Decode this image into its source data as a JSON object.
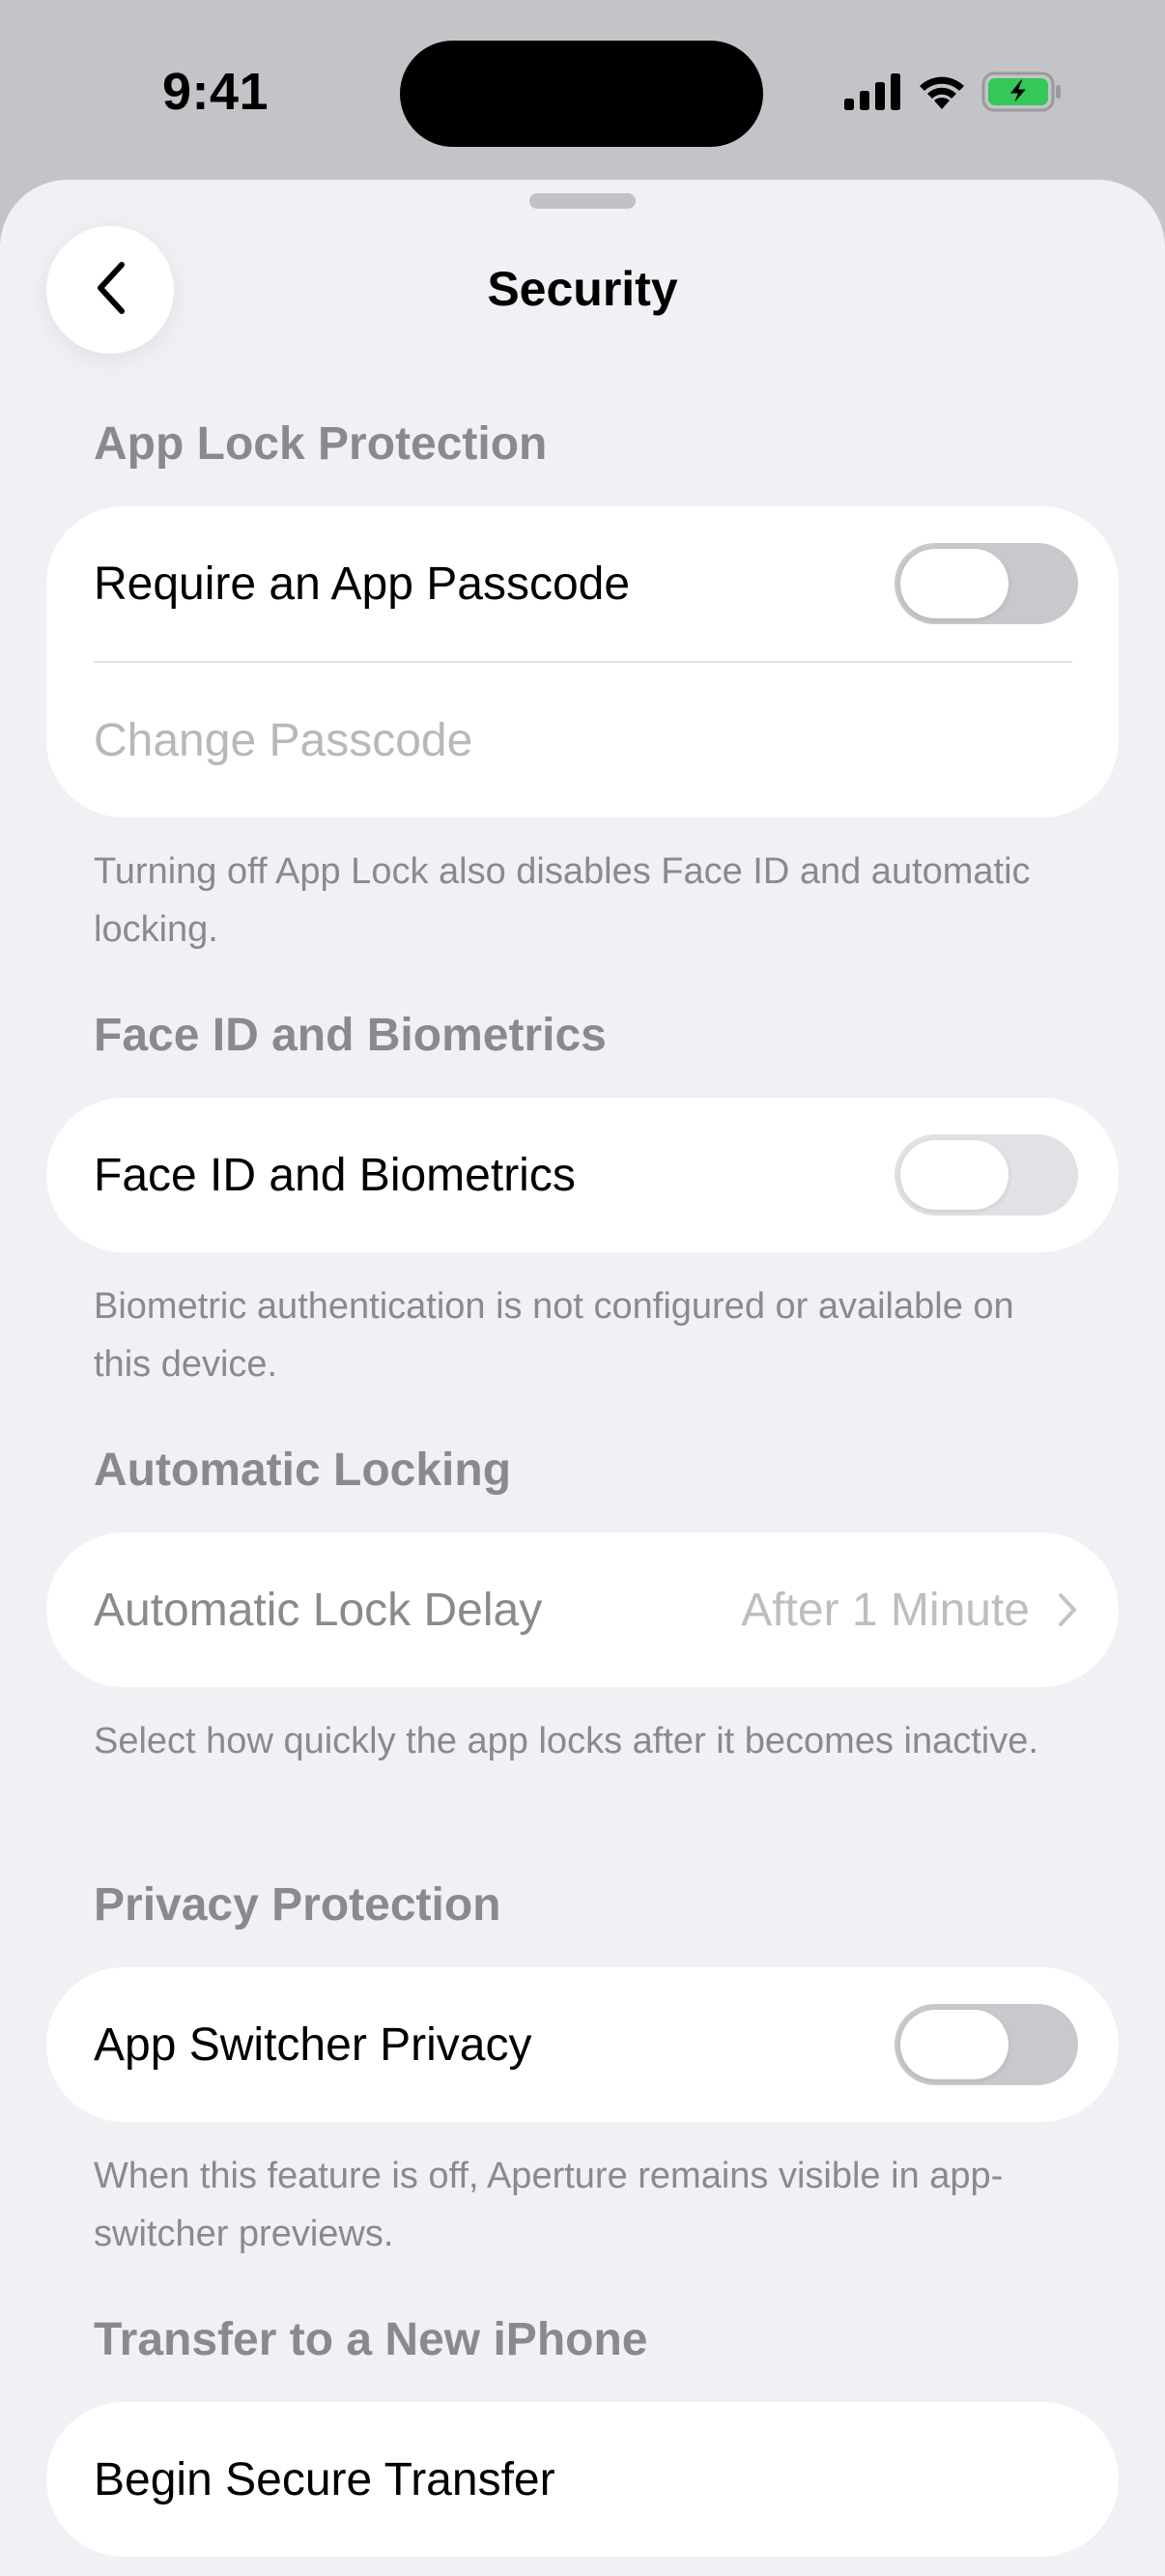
{
  "status_bar": {
    "time": "9:41",
    "icons": [
      "cellular-signal-icon",
      "wifi-icon",
      "battery-charging-icon"
    ],
    "battery_color": "#34c759"
  },
  "nav": {
    "title": "Security",
    "back_icon": "chevron-left-icon"
  },
  "sections": {
    "app_lock": {
      "header": "App Lock Protection",
      "require_passcode_label": "Require an App Passcode",
      "require_passcode_enabled": false,
      "change_passcode_label": "Change Passcode",
      "footer": "Turning off App Lock also disables Face ID and automatic locking."
    },
    "biometrics": {
      "header": "Face ID and Biometrics",
      "toggle_label": "Face ID and Biometrics",
      "toggle_enabled": false,
      "footer": "Biometric authentication is not configured or available on this device."
    },
    "auto_lock": {
      "header": "Automatic Locking",
      "delay_label": "Automatic Lock Delay",
      "delay_value": "After 1 Minute",
      "footer": "Select how quickly the app locks after it becomes inactive."
    },
    "privacy": {
      "header": "Privacy Protection",
      "switcher_label": "App Switcher Privacy",
      "switcher_enabled": false,
      "footer": "When this feature is off, Aperture remains visible in app-switcher previews."
    },
    "transfer": {
      "header": "Transfer to a New iPhone",
      "begin_label": "Begin Secure Transfer"
    }
  },
  "colors": {
    "sheet_background": "#f1f0f5",
    "secondary_text": "#8a8a8e",
    "toggle_off": "#c9c9cd"
  }
}
